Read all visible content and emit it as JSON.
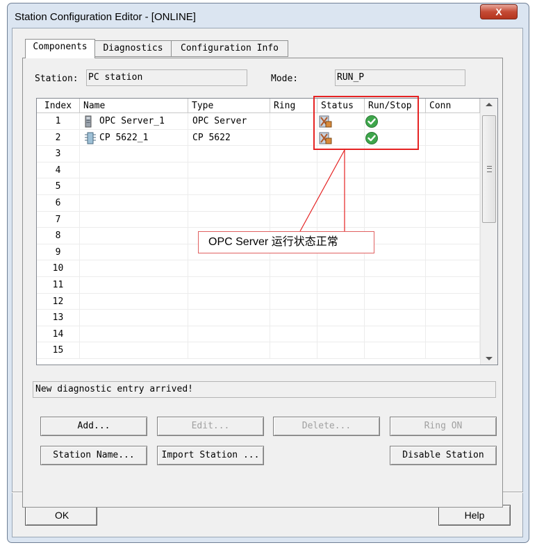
{
  "window": {
    "title": "Station Configuration Editor - [ONLINE]",
    "close_label": "X"
  },
  "tabs": [
    "Components",
    "Diagnostics",
    "Configuration Info"
  ],
  "station": {
    "label": "Station:",
    "value": "PC station",
    "mode_label": "Mode:",
    "mode_value": "RUN_P"
  },
  "grid": {
    "headers": [
      "Index",
      "Name",
      "Type",
      "Ring",
      "Status",
      "Run/Stop",
      "Conn"
    ],
    "rows": [
      {
        "index": "1",
        "name": "OPC Server_1",
        "type": "OPC Server",
        "icon": "opc-server-icon",
        "status_icon": "status-ok-icon",
        "runstop_icon": "run-check-icon"
      },
      {
        "index": "2",
        "name": "CP 5622_1",
        "type": "CP 5622",
        "icon": "cp-card-icon",
        "status_icon": "status-ok-icon",
        "runstop_icon": "run-check-icon"
      },
      {
        "index": "3"
      },
      {
        "index": "4"
      },
      {
        "index": "5"
      },
      {
        "index": "6"
      },
      {
        "index": "7"
      },
      {
        "index": "8"
      },
      {
        "index": "9"
      },
      {
        "index": "10"
      },
      {
        "index": "11"
      },
      {
        "index": "12"
      },
      {
        "index": "13"
      },
      {
        "index": "14"
      },
      {
        "index": "15"
      }
    ]
  },
  "annotation": {
    "text": "OPC Server 运行状态正常",
    "color": "#e52222"
  },
  "status_bar": {
    "text": "New diagnostic entry arrived!"
  },
  "buttons": {
    "add": "Add...",
    "edit": "Edit...",
    "delete": "Delete...",
    "ring_on": "Ring ON",
    "station_name": "Station Name...",
    "import_station": "Import Station ...",
    "disable_station": "Disable Station",
    "ok": "OK",
    "help": "Help"
  },
  "colors": {
    "accent_red": "#e52222",
    "ok_green": "#3ea64b"
  }
}
